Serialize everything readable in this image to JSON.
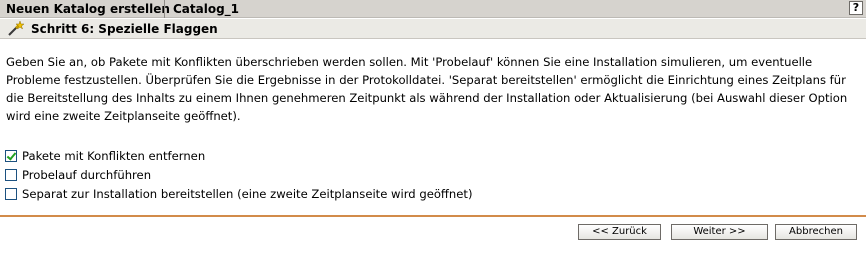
{
  "titlebar": {
    "title": "Neuen Katalog erstellen",
    "catalog_name": "Catalog_1",
    "help_label": "?"
  },
  "step": {
    "icon": "wizard-wand-icon",
    "title": "Schritt 6: Spezielle Flaggen"
  },
  "description": {
    "line1": "Geben Sie an, ob Pakete mit Konflikten überschrieben werden sollen. Mit 'Probelauf' können Sie eine Installation simulieren, um eventuelle",
    "line2": "Probleme festzustellen. Überprüfen Sie die Ergebnisse in der Protokolldatei. 'Separat bereitstellen' ermöglicht die Einrichtung eines Zeitplans für",
    "line3": "die Bereitstellung des Inhalts zu einem Ihnen genehmeren Zeitpunkt als während der Installation oder Aktualisierung (bei Auswahl dieser Option",
    "line4": "wird eine zweite Zeitplanseite geöffnet)."
  },
  "options": [
    {
      "label": "Pakete mit Konflikten entfernen",
      "checked": true
    },
    {
      "label": "Probelauf durchführen",
      "checked": false
    },
    {
      "label": "Separat zur Installation bereitstellen (eine zweite Zeitplanseite wird geöffnet)",
      "checked": false
    }
  ],
  "buttons": {
    "back": "<< Zurück",
    "next": "Weiter >>",
    "cancel": "Abbrechen"
  },
  "colors": {
    "divider": "#d28b4a",
    "checkmark": "#21a121",
    "titlebar_bg": "#d6d3ce",
    "stepbar_bg": "#ebeae5"
  }
}
